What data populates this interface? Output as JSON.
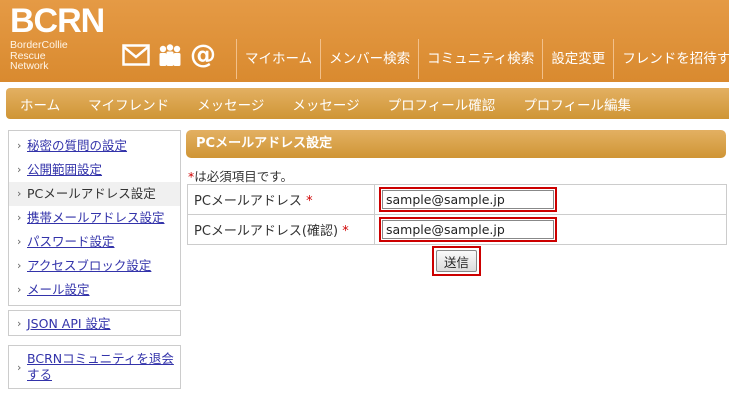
{
  "logo": {
    "main": "BCRN",
    "sub_lines": [
      "BorderCollie",
      "Rescue",
      "Network"
    ]
  },
  "header_icons": [
    "mail-icon",
    "members-icon",
    "at-icon"
  ],
  "at_symbol": "@",
  "top_nav": [
    "マイホーム",
    "メンバー検索",
    "コミュニティ検索",
    "設定変更",
    "フレンドを招待す"
  ],
  "sub_nav": [
    "ホーム",
    "マイフレンド",
    "メッセージ",
    "メッセージ",
    "プロフィール確認",
    "プロフィール編集"
  ],
  "sidebar": {
    "chevron": "›",
    "group1": [
      {
        "label": "秘密の質問の設定",
        "active": false
      },
      {
        "label": "公開範囲設定",
        "active": false
      },
      {
        "label": "PCメールアドレス設定",
        "active": true
      },
      {
        "label": "携帯メールアドレス設定",
        "active": false
      },
      {
        "label": "パスワード設定",
        "active": false
      },
      {
        "label": "アクセスブロック設定",
        "active": false
      },
      {
        "label": "メール設定",
        "active": false
      }
    ],
    "group2": [
      {
        "label": "JSON API 設定"
      }
    ],
    "group3": [
      {
        "label": "BCRNコミュニティを退会する"
      }
    ]
  },
  "main": {
    "section_title": "PCメールアドレス設定",
    "required_mark": "*",
    "required_note": "は必須項目です。",
    "fields": [
      {
        "label": "PCメールアドレス",
        "value": "sample@sample.jp"
      },
      {
        "label": "PCメールアドレス(確認)",
        "value": "sample@sample.jp"
      }
    ],
    "submit_label": "送信"
  },
  "colors": {
    "header_orange": "#dd8f35",
    "nav_gold": "#d9a24a",
    "link_blue": "#3333aa",
    "required_red": "#d00000",
    "highlight_red": "#cc0000"
  }
}
